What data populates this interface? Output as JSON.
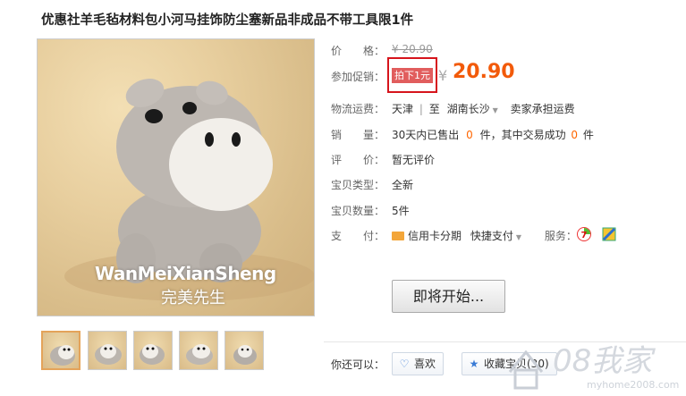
{
  "product": {
    "title": "优惠社羊毛毡材料包小河马挂饰防尘塞新品非成品不带工具限1件",
    "image_brand_text": "WanMeiXianSheng",
    "image_brand_cn": "完美先生"
  },
  "price": {
    "label": "价　　格：",
    "original": "¥ 20.90"
  },
  "promo": {
    "label": "参加促销：",
    "tag": "拍下1元",
    "currency": "¥",
    "price": "20.90"
  },
  "shipping": {
    "label": "物流运费：",
    "from": "天津",
    "sep": "|",
    "to_prefix": "至",
    "to": "湖南长沙",
    "note": "卖家承担运费"
  },
  "sales": {
    "label": "销　　量：",
    "prefix": "30天内已售出",
    "count": "0",
    "mid": "件，其中交易成功",
    "success": "0",
    "suffix": "件"
  },
  "review": {
    "label": "评　　价：",
    "value": "暂无评价"
  },
  "condition": {
    "label": "宝贝类型：",
    "value": "全新"
  },
  "quantity": {
    "label": "宝贝数量：",
    "value": "5件"
  },
  "payment": {
    "label": "支　　付：",
    "credit": "信用卡分期",
    "quick": "快捷支付",
    "service_label": "服务："
  },
  "buy": {
    "label": "即将开始..."
  },
  "share": {
    "label": "你还可以：",
    "like": "喜欢",
    "fav": "收藏宝贝(30)"
  },
  "watermark": {
    "main": "08我家",
    "sub": "myhome2008.com"
  },
  "colors": {
    "accent": "#f25a0a",
    "promo_bg": "#e15d5d",
    "highlight_box": "#d6141c"
  }
}
